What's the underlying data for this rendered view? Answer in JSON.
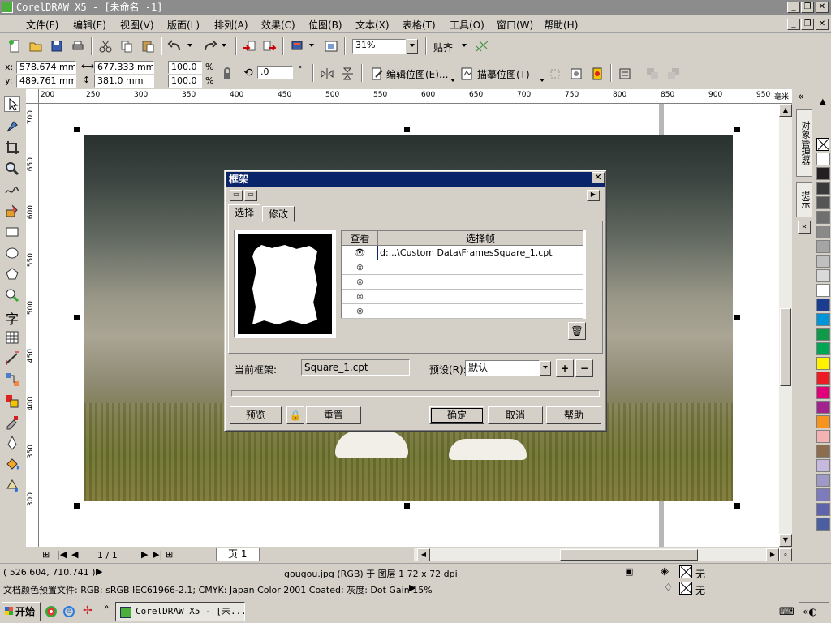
{
  "window": {
    "title": "CorelDRAW X5 - [未命名 -1]",
    "min": "_",
    "restore": "❐",
    "close": "✕"
  },
  "menu": [
    "文件(F)",
    "编辑(E)",
    "视图(V)",
    "版面(L)",
    "排列(A)",
    "效果(C)",
    "位图(B)",
    "文本(X)",
    "表格(T)",
    "工具(O)",
    "窗口(W)",
    "帮助(H)"
  ],
  "toolbar": {
    "zoom": "31%",
    "snap_label": "贴齐"
  },
  "propbar": {
    "x_label": "x:",
    "x": "578.674 mm",
    "y_label": "y:",
    "y": "489.761 mm",
    "width": "677.333 mm",
    "height": "381.0 mm",
    "scale_w": "100.0",
    "scale_h": "100.0",
    "percent": "%",
    "rotation": ".0",
    "degree": "°",
    "edit_bitmap": "编辑位图(E)...",
    "trace_bitmap": "描摹位图(T)"
  },
  "ruler": {
    "unit": "毫米",
    "h_ticks": [
      "200",
      "250",
      "300",
      "350",
      "400",
      "450",
      "500",
      "550",
      "600",
      "650",
      "700",
      "750",
      "800",
      "850",
      "900",
      "950"
    ],
    "v_ticks": [
      "700",
      "650",
      "600",
      "550",
      "500",
      "450",
      "400",
      "350",
      "300"
    ]
  },
  "dialog": {
    "title": "框架",
    "tab_select": "选择",
    "tab_modify": "修改",
    "col_view": "查看",
    "col_frame": "选择帧",
    "rows": [
      "d:...\\Custom Data\\FramesSquare_1.cpt",
      "",
      "",
      "",
      ""
    ],
    "current_frame_label": "当前框架:",
    "current_frame": "Square_1.cpt",
    "preset_label": "预设(R):",
    "preset_value": "默认",
    "plus": "+",
    "minus": "−",
    "preview_btn": "预览",
    "reset_btn": "重置",
    "ok_btn": "确定",
    "cancel_btn": "取消",
    "help_btn": "帮助"
  },
  "dockers": {
    "object_manager": "对象管理器",
    "hints": "提示"
  },
  "pager": {
    "page_count": "1 / 1",
    "page_tab": "页 1"
  },
  "status": {
    "coords": "( 526.604, 710.741 )",
    "object_info": "gougou.jpg (RGB) 于 图层 1 72 x 72 dpi",
    "fill_none": "无",
    "outline_none": "无",
    "color_profile": "文档颜色预置文件: RGB: sRGB IEC61966-2.1; CMYK: Japan Color 2001 Coated; 灰度: Dot Gain 15%"
  },
  "taskbar": {
    "start": "开始",
    "task": "CorelDRAW X5 - [未..."
  },
  "palette": [
    "#ffffff",
    "#231f20",
    "#3a3a3a",
    "#555555",
    "#6f6f6f",
    "#8a8a8a",
    "#a5a5a5",
    "#bfbfbf",
    "#d9d9d9",
    "#ffffff",
    "#1b3d8f",
    "#0094d8",
    "#0e9a48",
    "#00a651",
    "#fff200",
    "#ed1c24",
    "#e2007a",
    "#a3238e",
    "#f7941d",
    "#f5b2b2",
    "#8c6d4d",
    "#c7b8e0",
    "#9f99c8",
    "#7d7bbe",
    "#5e63ab",
    "#4a5ea0"
  ]
}
